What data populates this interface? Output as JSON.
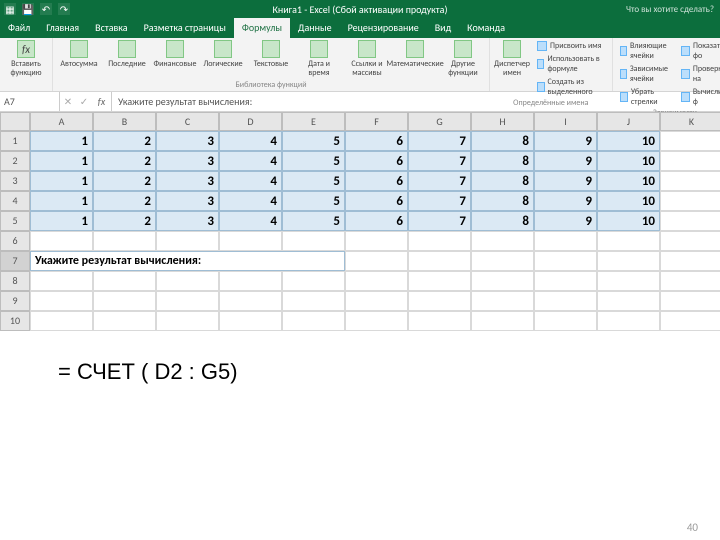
{
  "titlebar": {
    "title": "Книга1 - Excel (Сбой активации продукта)",
    "help_hint": "Что вы хотите сделать?"
  },
  "tabs": {
    "items": [
      "Файл",
      "Главная",
      "Вставка",
      "Разметка страницы",
      "Формулы",
      "Данные",
      "Рецензирование",
      "Вид",
      "Команда"
    ],
    "active_index": 4
  },
  "ribbon": {
    "g1_btn": "Вставить функцию",
    "g2": [
      "Автосумма",
      "Последние",
      "Финансовые",
      "Логические",
      "Текстовые",
      "Дата и время",
      "Ссылки и массивы",
      "Математические",
      "Другие функции"
    ],
    "g2_label": "Библиотека функций",
    "g3_btn": "Диспетчер имен",
    "g3_items": [
      "Присвоить имя",
      "Использовать в формуле",
      "Создать из выделенного"
    ],
    "g3_label": "Определённые имена",
    "g4_left": [
      "Влияющие ячейки",
      "Зависимые ячейки",
      "Убрать стрелки"
    ],
    "g4_right": [
      "Показать фо",
      "Проверка на",
      "Вычислить ф"
    ],
    "g4_label": "Зависимости"
  },
  "formula_bar": {
    "namebox": "A7",
    "fx": "fx",
    "content": "Укажите результат вычисления:"
  },
  "grid": {
    "cols": [
      "A",
      "B",
      "C",
      "D",
      "E",
      "F",
      "G",
      "H",
      "I",
      "J",
      "K"
    ],
    "rows": [
      1,
      2,
      3,
      4,
      5,
      6,
      7,
      8,
      9,
      10
    ],
    "data": [
      [
        1,
        2,
        3,
        4,
        5,
        6,
        7,
        8,
        9,
        10
      ],
      [
        1,
        2,
        3,
        4,
        5,
        6,
        7,
        8,
        9,
        10
      ],
      [
        1,
        2,
        3,
        4,
        5,
        6,
        7,
        8,
        9,
        10
      ],
      [
        1,
        2,
        3,
        4,
        5,
        6,
        7,
        8,
        9,
        10
      ],
      [
        1,
        2,
        3,
        4,
        5,
        6,
        7,
        8,
        9,
        10
      ]
    ],
    "prompt": "Укажите результат вычисления:"
  },
  "overlay_formula": "= СЧЕТ ( D2 : G5)",
  "page_number": "40"
}
